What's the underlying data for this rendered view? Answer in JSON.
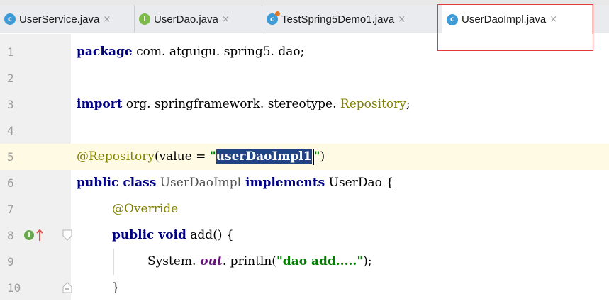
{
  "tabs": [
    {
      "label": "UserService.java",
      "icon": "class-icon",
      "color": "#3d9bd8",
      "icon_char": "c"
    },
    {
      "label": "UserDao.java",
      "icon": "interface-icon",
      "color": "#7cba4a",
      "icon_char": "I"
    },
    {
      "label": "TestSpring5Demo1.java",
      "icon": "test-class-icon",
      "color": "#3d9bd8",
      "icon_char": "c"
    },
    {
      "label": "UserDaoImpl.java",
      "icon": "class-icon",
      "color": "#3d9bd8",
      "icon_char": "c",
      "active": true
    }
  ],
  "close_glyph": "×",
  "highlight_box_color": "#e53935",
  "lines": {
    "l1": {
      "num": "1",
      "kw": "package",
      "rest": " com. atguigu. spring5. dao;"
    },
    "l2": {
      "num": "2"
    },
    "l3": {
      "num": "3",
      "kw": "import",
      "rest": " org. springframework. stereotype.",
      "cls": " Repository",
      "end": ";"
    },
    "l4": {
      "num": "4"
    },
    "l5": {
      "num": "5",
      "ann": "@Repository",
      "mid": "(value = ",
      "q1": "\"",
      "sel": "userDaoImpl1",
      "q2": "\"",
      "end": ")"
    },
    "l6": {
      "num": "6",
      "kw1": "public",
      "kw2": " class",
      "name": " UserDaoImpl",
      "kw3": " implements",
      "rest": " UserDao {"
    },
    "l7": {
      "num": "7",
      "ann": "@Override"
    },
    "l8": {
      "num": "8",
      "kw1": "public",
      "kw2": " void",
      "rest": " add() {"
    },
    "l9": {
      "num": "9",
      "pre": "System.",
      "field": " out",
      "mid": ". println(",
      "str": "\"dao add.....\"",
      "end": ");"
    },
    "l10": {
      "num": "10",
      "rest": "}"
    }
  }
}
